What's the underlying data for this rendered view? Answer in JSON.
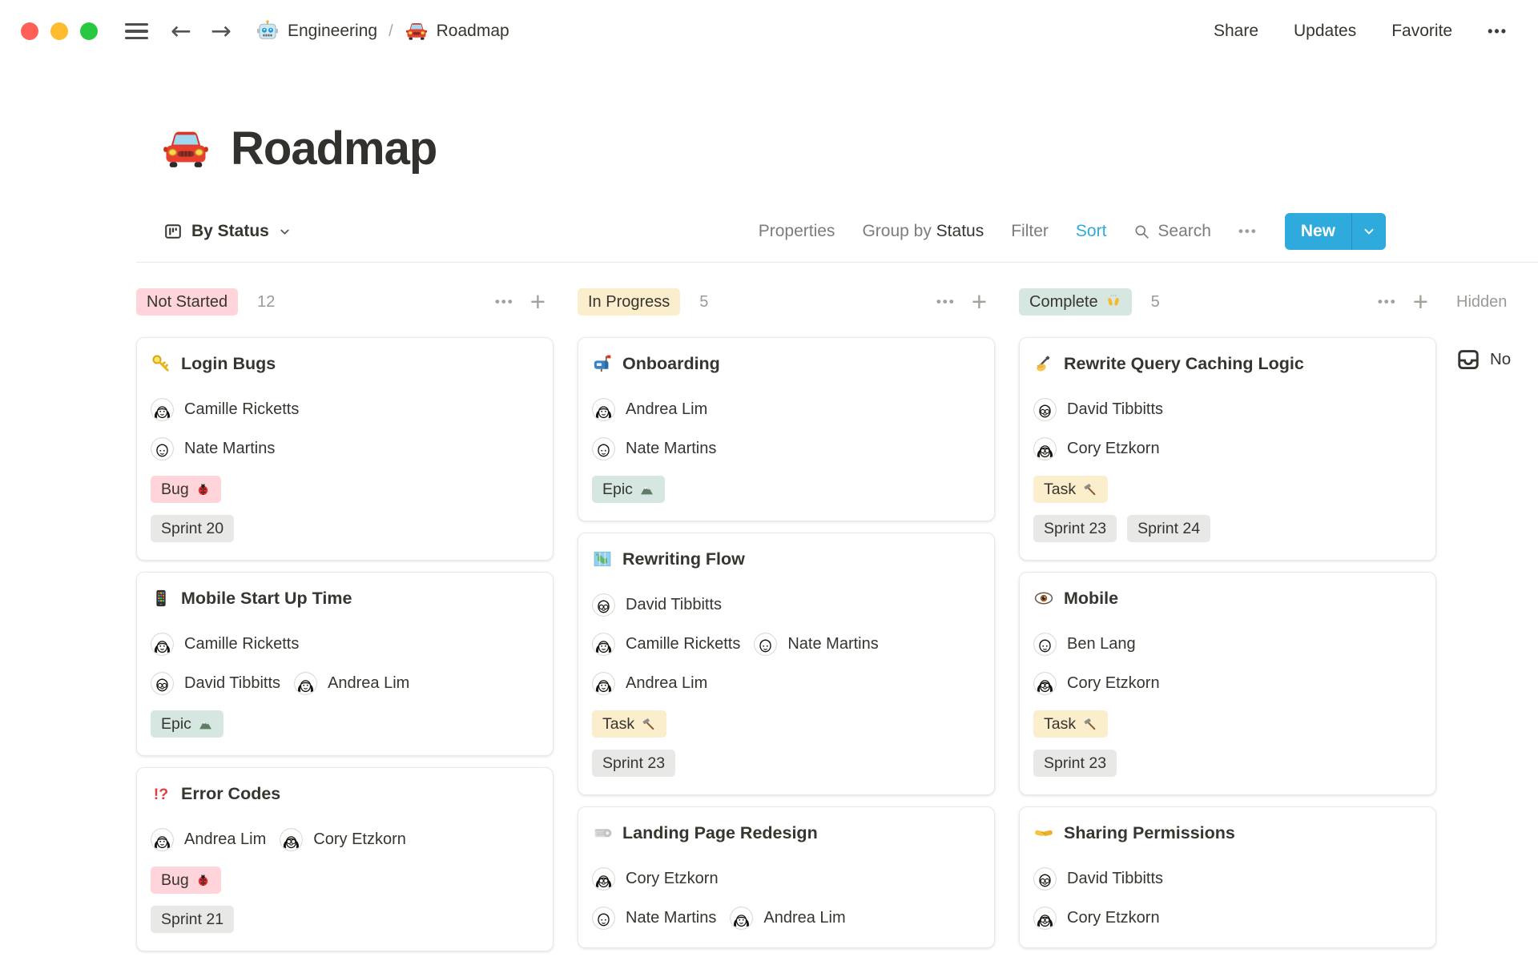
{
  "window_controls": {
    "close": "#ff5f57",
    "minimize": "#febc2e",
    "zoom_btn": "#28c840"
  },
  "topbar": {
    "back": "←",
    "forward": "→",
    "breadcrumb": [
      {
        "icon": "robot-icon",
        "label": "Engineering"
      },
      {
        "icon": "car-icon",
        "label": "Roadmap"
      }
    ],
    "separator": "/",
    "actions": {
      "share": "Share",
      "updates": "Updates",
      "favorite": "Favorite",
      "more": "•••"
    }
  },
  "page": {
    "icon": "car-icon",
    "title": "Roadmap"
  },
  "toolbar": {
    "view": {
      "icon": "board-icon",
      "label": "By Status"
    },
    "properties": "Properties",
    "group_by": "Group by",
    "group_by_value": "Status",
    "filter": "Filter",
    "sort": "Sort",
    "search": "Search",
    "more": "•••",
    "new": "New"
  },
  "board": {
    "columns": [
      {
        "id": "not-started",
        "label": "Not Started",
        "color": "pink",
        "count": "12",
        "more": "•••",
        "add": "+",
        "cards": [
          {
            "icon": "key-icon",
            "title": "Login Bugs",
            "people": [
              [
                {
                  "name": "Camille Ricketts",
                  "avatar": "bob"
                }
              ],
              [
                {
                  "name": "Nate Martins",
                  "avatar": "short"
                }
              ]
            ],
            "tags": [
              [
                {
                  "label": "Bug",
                  "icon": "ladybug-icon",
                  "color": "pink"
                }
              ],
              [
                {
                  "label": "Sprint 20",
                  "color": "gray"
                }
              ]
            ]
          },
          {
            "icon": "mobile-icon",
            "title": "Mobile Start Up Time",
            "people": [
              [
                {
                  "name": "Camille Ricketts",
                  "avatar": "bob"
                }
              ],
              [
                {
                  "name": "David Tibbitts",
                  "avatar": "short-glasses"
                },
                {
                  "name": "Andrea Lim",
                  "avatar": "bob"
                }
              ]
            ],
            "tags": [
              [
                {
                  "label": "Epic",
                  "icon": "mountain-icon",
                  "color": "teal"
                }
              ]
            ]
          },
          {
            "icon": "interrobang-icon",
            "title": "Error Codes",
            "people": [
              [
                {
                  "name": "Andrea Lim",
                  "avatar": "bob"
                },
                {
                  "name": "Cory Etzkorn",
                  "avatar": "bob-glasses"
                }
              ]
            ],
            "tags": [
              [
                {
                  "label": "Bug",
                  "icon": "ladybug-icon",
                  "color": "pink"
                }
              ],
              [
                {
                  "label": "Sprint 21",
                  "color": "gray"
                }
              ]
            ]
          }
        ]
      },
      {
        "id": "in-progress",
        "label": "In Progress",
        "color": "yellow",
        "count": "5",
        "more": "•••",
        "add": "+",
        "cards": [
          {
            "icon": "mailbox-icon",
            "title": "Onboarding",
            "people": [
              [
                {
                  "name": "Andrea Lim",
                  "avatar": "bob"
                }
              ],
              [
                {
                  "name": "Nate Martins",
                  "avatar": "short"
                }
              ]
            ],
            "tags": [
              [
                {
                  "label": "Epic",
                  "icon": "mountain-icon",
                  "color": "teal"
                }
              ]
            ]
          },
          {
            "icon": "map-icon",
            "title": "Rewriting Flow",
            "people": [
              [
                {
                  "name": "David Tibbitts",
                  "avatar": "short-glasses"
                }
              ],
              [
                {
                  "name": "Camille Ricketts",
                  "avatar": "bob"
                },
                {
                  "name": "Nate Martins",
                  "avatar": "short"
                }
              ],
              [
                {
                  "name": "Andrea Lim",
                  "avatar": "bob"
                }
              ]
            ],
            "tags": [
              [
                {
                  "label": "Task",
                  "icon": "hammer-icon",
                  "color": "yellow"
                }
              ],
              [
                {
                  "label": "Sprint 23",
                  "color": "gray"
                }
              ]
            ]
          },
          {
            "icon": "scroll-icon",
            "title": "Landing Page Redesign",
            "people": [
              [
                {
                  "name": "Cory Etzkorn",
                  "avatar": "bob-glasses"
                }
              ],
              [
                {
                  "name": "Nate Martins",
                  "avatar": "short"
                },
                {
                  "name": "Andrea Lim",
                  "avatar": "bob"
                }
              ]
            ],
            "tags": []
          }
        ]
      },
      {
        "id": "complete",
        "label": "Complete",
        "label_icon": "raised-hands-icon",
        "color": "teal",
        "count": "5",
        "more": "•••",
        "add": "+",
        "cards": [
          {
            "icon": "writing-hand-icon",
            "title": "Rewrite Query Caching Logic",
            "people": [
              [
                {
                  "name": "David Tibbitts",
                  "avatar": "short-glasses"
                }
              ],
              [
                {
                  "name": "Cory Etzkorn",
                  "avatar": "bob-glasses"
                }
              ]
            ],
            "tags": [
              [
                {
                  "label": "Task",
                  "icon": "hammer-icon",
                  "color": "yellow"
                }
              ],
              [
                {
                  "label": "Sprint 23",
                  "color": "gray"
                },
                {
                  "label": "Sprint 24",
                  "color": "gray"
                }
              ]
            ]
          },
          {
            "icon": "eye-icon",
            "title": "Mobile",
            "people": [
              [
                {
                  "name": "Ben Lang",
                  "avatar": "short"
                }
              ],
              [
                {
                  "name": "Cory Etzkorn",
                  "avatar": "bob-glasses"
                }
              ]
            ],
            "tags": [
              [
                {
                  "label": "Task",
                  "icon": "hammer-icon",
                  "color": "yellow"
                }
              ],
              [
                {
                  "label": "Sprint 23",
                  "color": "gray"
                }
              ]
            ]
          },
          {
            "icon": "handshake-icon",
            "title": "Sharing Permissions",
            "people": [
              [
                {
                  "name": "David Tibbitts",
                  "avatar": "short-glasses"
                }
              ],
              [
                {
                  "name": "Cory Etzkorn",
                  "avatar": "bob-glasses"
                }
              ]
            ],
            "tags": []
          }
        ]
      }
    ],
    "hidden": {
      "label": "Hidden",
      "group": {
        "icon": "inbox-icon",
        "label": "No"
      }
    }
  },
  "colors": {
    "pink": "#ffd4da",
    "yellow": "#fbeecd",
    "teal": "#d6e6e0",
    "gray": "#e8e8e6",
    "accent": "#2eaadc",
    "text": "#37352f",
    "muted": "#7e7c78",
    "faint": "#9b9a97"
  }
}
